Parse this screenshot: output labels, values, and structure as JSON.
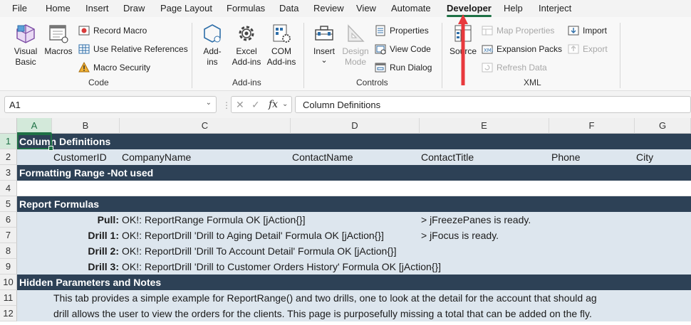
{
  "menu": {
    "tabs": [
      "File",
      "Home",
      "Insert",
      "Draw",
      "Page Layout",
      "Formulas",
      "Data",
      "Review",
      "View",
      "Automate",
      "Developer",
      "Help",
      "Interject"
    ],
    "active": "Developer"
  },
  "ribbon": {
    "code": {
      "label": "Code",
      "visual_basic": [
        "Visual",
        "Basic"
      ],
      "macros": "Macros",
      "record_macro": "Record Macro",
      "relative_refs": "Use Relative References",
      "macro_security": "Macro Security"
    },
    "addins": {
      "label": "Add-ins",
      "addins": [
        "Add-",
        "ins"
      ],
      "excel_addins": [
        "Excel",
        "Add-ins"
      ],
      "com_addins": [
        "COM",
        "Add-ins"
      ]
    },
    "controls": {
      "label": "Controls",
      "insert": "Insert",
      "insert_caret": "⌄",
      "design_mode": [
        "Design",
        "Mode"
      ],
      "properties": "Properties",
      "view_code": "View Code",
      "run_dialog": "Run Dialog"
    },
    "xml": {
      "label": "XML",
      "source": "Source",
      "map_properties": "Map Properties",
      "expansion_packs": "Expansion Packs",
      "refresh_data": "Refresh Data",
      "import": "Import",
      "export": "Export"
    }
  },
  "formula_bar": {
    "name_box": "A1",
    "fx": "fx",
    "content": "Column Definitions"
  },
  "grid": {
    "columns": [
      "A",
      "B",
      "C",
      "D",
      "E",
      "F",
      "G"
    ],
    "selected_column": "A",
    "rows": [
      "1",
      "2",
      "3",
      "4",
      "5",
      "6",
      "7",
      "8",
      "9",
      "10",
      "11",
      "12"
    ],
    "selected_row": "1",
    "r1": "Column Definitions",
    "r2": [
      "CustomerID",
      "CompanyName",
      "ContactName",
      "ContactTitle",
      "Phone",
      "City"
    ],
    "r3": "Formatting Range -Not used",
    "r5": "Report Formulas",
    "r6": {
      "label": "Pull:",
      "text": "OK!: ReportRange Formula OK [jAction{}]",
      "note": "> jFreezePanes is ready."
    },
    "r7": {
      "label": "Drill 1:",
      "text": "OK!: ReportDrill 'Drill to Aging Detail' Formula OK [jAction{}]",
      "note": "> jFocus is ready."
    },
    "r8": {
      "label": "Drill 2:",
      "text": "OK!: ReportDrill 'Drill To Account Detail' Formula OK [jAction{}]"
    },
    "r9": {
      "label": "Drill 3:",
      "text": "OK!: ReportDrill 'Drill to Customer Orders History' Formula OK [jAction{}]"
    },
    "r10": "Hidden Parameters and Notes",
    "r11": "This tab provides a simple example for ReportRange() and two drills, one to look at the detail for the account that should ag",
    "r12": "drill allows the user to view the orders for the clients.   This page is purposefully missing a total that can be added on the fly."
  },
  "colors": {
    "accent": "#1e7145",
    "header_band": "#2d4156",
    "light_band": "#dde6ee",
    "annotation_arrow": "#e8393d"
  }
}
